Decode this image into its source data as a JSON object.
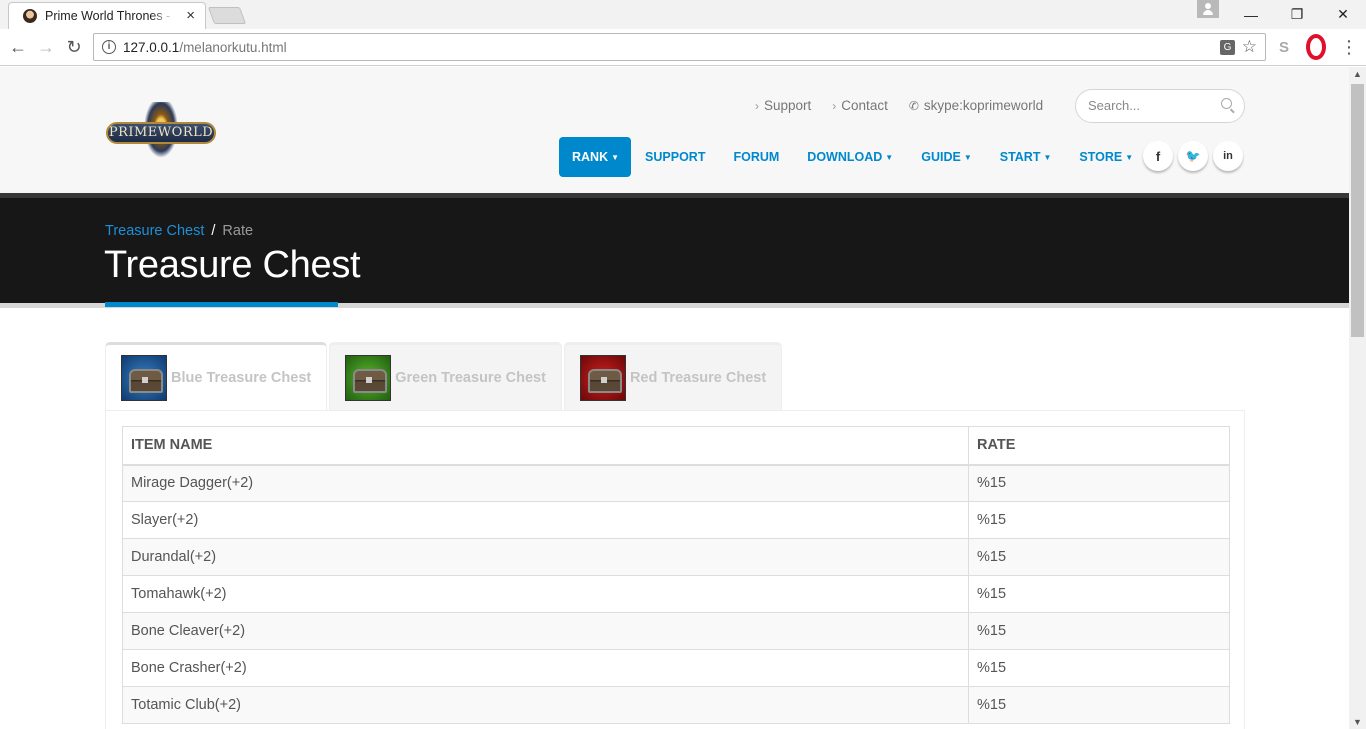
{
  "browser": {
    "tab_title": "Prime World Thrones - K",
    "tab_close": "×",
    "url_host": "127.0.0.1",
    "url_path": "/melanorkutu.html",
    "window_controls": [
      "—",
      "❐",
      "✕"
    ]
  },
  "header": {
    "logo_text": "PRIMEWORLD",
    "top_links": [
      {
        "label": "Support"
      },
      {
        "label": "Contact"
      },
      {
        "label": "skype:koprimeworld"
      }
    ],
    "search_placeholder": "Search...",
    "nav": [
      {
        "label": "RANK",
        "dropdown": true,
        "active": true
      },
      {
        "label": "SUPPORT",
        "dropdown": false
      },
      {
        "label": "FORUM",
        "dropdown": false
      },
      {
        "label": "DOWNLOAD",
        "dropdown": true
      },
      {
        "label": "GUIDE",
        "dropdown": true
      },
      {
        "label": "START",
        "dropdown": true
      },
      {
        "label": "STORE",
        "dropdown": true
      }
    ],
    "social": [
      {
        "icon": "facebook-icon",
        "glyph": "f"
      },
      {
        "icon": "twitter-icon",
        "glyph": "🐦"
      },
      {
        "icon": "linkedin-icon",
        "glyph": "in"
      }
    ]
  },
  "page": {
    "breadcrumb": {
      "link": "Treasure Chest",
      "separator": "/",
      "current": "Rate"
    },
    "title": "Treasure Chest",
    "accent_color": "#0088cc"
  },
  "chest_tabs": [
    {
      "label": "Blue Treasure Chest",
      "color": "blue",
      "active": true
    },
    {
      "label": "Green Treasure Chest",
      "color": "green",
      "active": false
    },
    {
      "label": "Red Treasure Chest",
      "color": "red",
      "active": false
    }
  ],
  "table": {
    "headers": [
      "ITEM NAME",
      "RATE"
    ],
    "rows": [
      [
        "Mirage Dagger(+2)",
        "%15"
      ],
      [
        "Slayer(+2)",
        "%15"
      ],
      [
        "Durandal(+2)",
        "%15"
      ],
      [
        "Tomahawk(+2)",
        "%15"
      ],
      [
        "Bone Cleaver(+2)",
        "%15"
      ],
      [
        "Bone Crasher(+2)",
        "%15"
      ],
      [
        "Totamic Club(+2)",
        "%15"
      ]
    ]
  }
}
